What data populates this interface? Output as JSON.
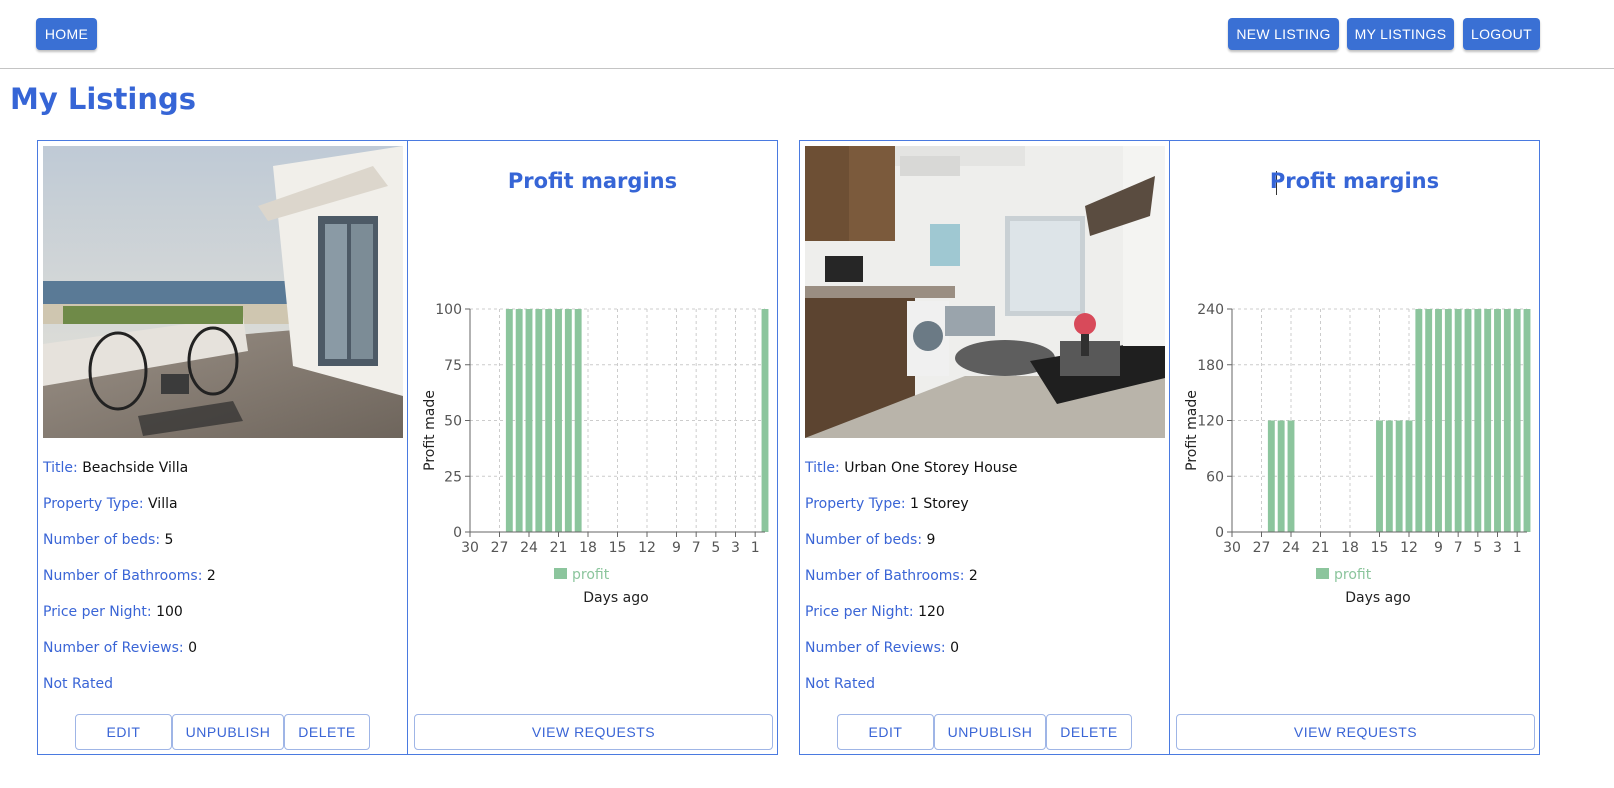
{
  "nav": {
    "home": "HOME",
    "new_listing": "NEW LISTING",
    "my_listings": "MY LISTINGS",
    "logout": "LOGOUT"
  },
  "page_title": "My Listings",
  "labels": {
    "title": "Title:",
    "property_type": "Property Type:",
    "beds": "Number of beds:",
    "bathrooms": "Number of Bathrooms:",
    "price": "Price per Night:",
    "reviews": "Number of Reviews:"
  },
  "buttons": {
    "edit": "EDIT",
    "unpublish": "UNPUBLISH",
    "delete": "DELETE",
    "view_requests": "VIEW REQUESTS"
  },
  "listings": [
    {
      "title": "Beachside Villa",
      "property_type": "Villa",
      "beds": "5",
      "bathrooms": "2",
      "price": "100",
      "reviews": "0",
      "rating": "Not Rated"
    },
    {
      "title": "Urban One Storey House",
      "property_type": "1 Storey",
      "beds": "9",
      "bathrooms": "2",
      "price": "120",
      "reviews": "0",
      "rating": "Not Rated"
    }
  ],
  "chart_data": [
    {
      "type": "bar",
      "title": "Profit margins",
      "xlabel": "Days ago",
      "ylabel": "Profit made",
      "legend": "bottom",
      "grid": true,
      "x_ticks": [
        "30",
        "27",
        "24",
        "21",
        "18",
        "15",
        "12",
        "9",
        "7",
        "5",
        "3",
        "1"
      ],
      "y_ticks": [
        "0",
        "25",
        "50",
        "75",
        "100"
      ],
      "ylim": [
        0,
        100
      ],
      "x": [
        30,
        29,
        28,
        27,
        26,
        25,
        24,
        23,
        22,
        21,
        20,
        19,
        18,
        17,
        16,
        15,
        14,
        13,
        12,
        11,
        10,
        9,
        8,
        7,
        6,
        5,
        4,
        3,
        2,
        1,
        0
      ],
      "series": [
        {
          "name": "profit",
          "color": "#8cc59d",
          "values": [
            0,
            0,
            0,
            0,
            100,
            100,
            100,
            100,
            100,
            100,
            100,
            100,
            0,
            0,
            0,
            0,
            0,
            0,
            0,
            0,
            0,
            0,
            0,
            0,
            0,
            0,
            0,
            0,
            0,
            0,
            100
          ]
        }
      ]
    },
    {
      "type": "bar",
      "title": "Profit margins",
      "xlabel": "Days ago",
      "ylabel": "Profit made",
      "legend": "bottom",
      "grid": true,
      "x_ticks": [
        "30",
        "27",
        "24",
        "21",
        "18",
        "15",
        "12",
        "9",
        "7",
        "5",
        "3",
        "1"
      ],
      "y_ticks": [
        "0",
        "60",
        "120",
        "180",
        "240"
      ],
      "ylim": [
        0,
        240
      ],
      "x": [
        30,
        29,
        28,
        27,
        26,
        25,
        24,
        23,
        22,
        21,
        20,
        19,
        18,
        17,
        16,
        15,
        14,
        13,
        12,
        11,
        10,
        9,
        8,
        7,
        6,
        5,
        4,
        3,
        2,
        1,
        0
      ],
      "series": [
        {
          "name": "profit",
          "color": "#8cc59d",
          "values": [
            0,
            0,
            0,
            0,
            120,
            120,
            120,
            0,
            0,
            0,
            0,
            0,
            0,
            0,
            0,
            120,
            120,
            120,
            120,
            240,
            240,
            240,
            240,
            240,
            240,
            240,
            240,
            240,
            240,
            240,
            240
          ]
        }
      ]
    }
  ]
}
